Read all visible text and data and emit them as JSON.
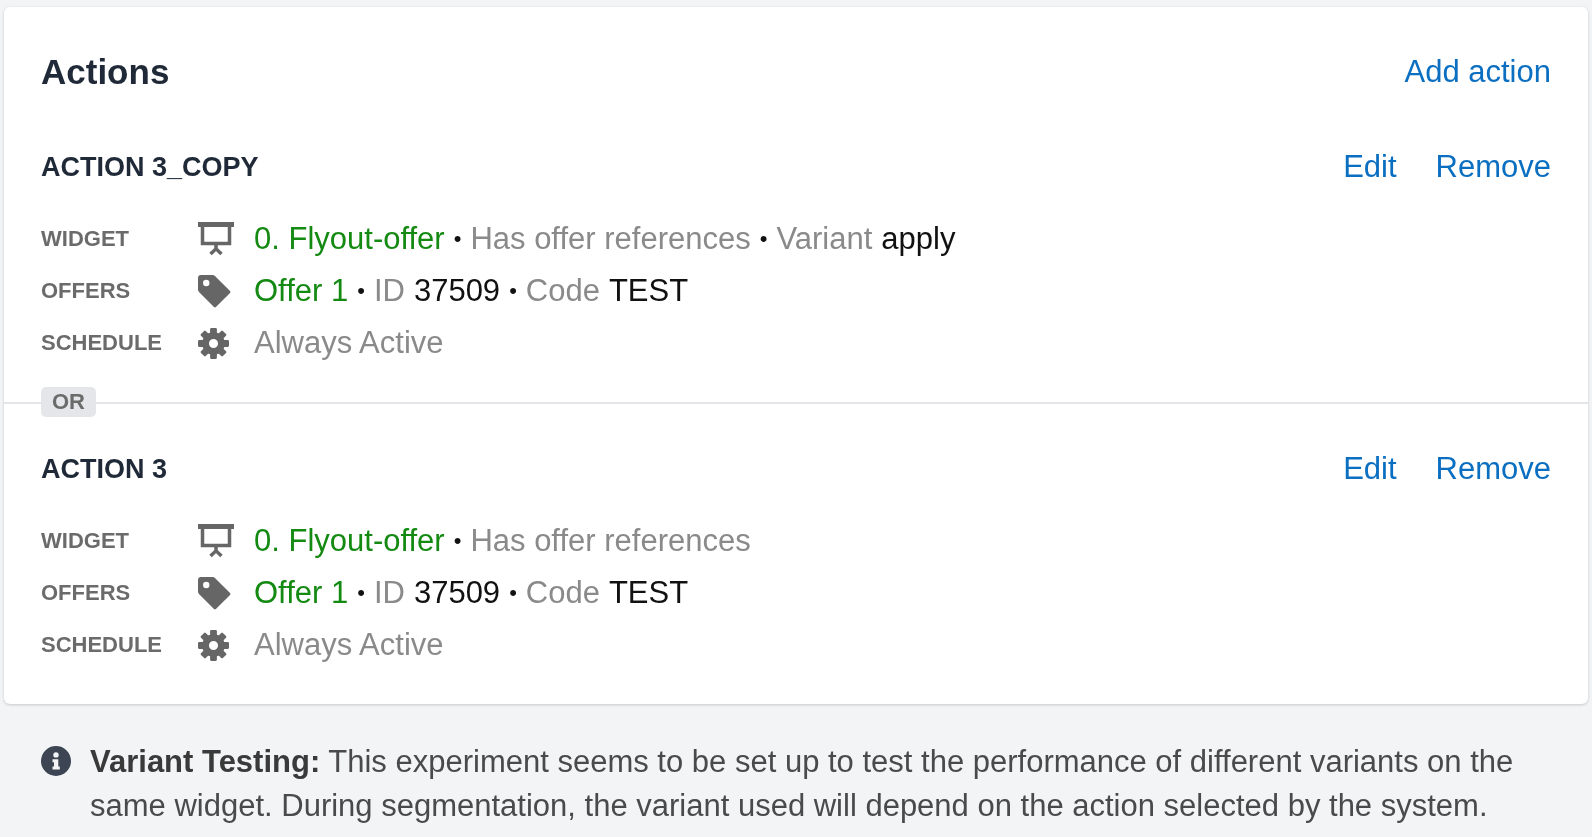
{
  "panel": {
    "title": "Actions",
    "add_link": "Add action"
  },
  "actions": [
    {
      "name": "ACTION 3_COPY",
      "links": [
        "Edit",
        "Remove"
      ],
      "details": [
        {
          "kind": "widget",
          "label": "WIDGET",
          "parts": [
            {
              "kind": "link",
              "text": "0. Flyout-offer"
            },
            {
              "kind": "bullet",
              "text": "•"
            },
            {
              "kind": "muted",
              "text": "Has offer references"
            },
            {
              "kind": "bullet",
              "text": "•"
            },
            {
              "kind": "muted",
              "text": "Variant"
            },
            {
              "kind": "strong",
              "text": "apply"
            }
          ]
        },
        {
          "kind": "offers",
          "label": "OFFERS",
          "parts": [
            {
              "kind": "link",
              "text": "Offer 1"
            },
            {
              "kind": "bullet",
              "text": "•"
            },
            {
              "kind": "muted",
              "text": "ID"
            },
            {
              "kind": "strong",
              "text": "37509"
            },
            {
              "kind": "bullet",
              "text": "•"
            },
            {
              "kind": "muted",
              "text": "Code"
            },
            {
              "kind": "strong",
              "text": "TEST"
            }
          ]
        },
        {
          "kind": "schedule",
          "label": "SCHEDULE",
          "parts": [
            {
              "kind": "muted",
              "text": "Always Active"
            }
          ]
        }
      ]
    },
    {
      "name": "ACTION 3",
      "links": [
        "Edit",
        "Remove"
      ],
      "details": [
        {
          "kind": "widget",
          "label": "WIDGET",
          "parts": [
            {
              "kind": "link",
              "text": "0. Flyout-offer"
            },
            {
              "kind": "bullet",
              "text": "•"
            },
            {
              "kind": "muted",
              "text": "Has offer references"
            }
          ]
        },
        {
          "kind": "offers",
          "label": "OFFERS",
          "parts": [
            {
              "kind": "link",
              "text": "Offer 1"
            },
            {
              "kind": "bullet",
              "text": "•"
            },
            {
              "kind": "muted",
              "text": "ID"
            },
            {
              "kind": "strong",
              "text": "37509"
            },
            {
              "kind": "bullet",
              "text": "•"
            },
            {
              "kind": "muted",
              "text": "Code"
            },
            {
              "kind": "strong",
              "text": "TEST"
            }
          ]
        },
        {
          "kind": "schedule",
          "label": "SCHEDULE",
          "parts": [
            {
              "kind": "muted",
              "text": "Always Active"
            }
          ]
        }
      ]
    }
  ],
  "separator": "OR",
  "note": {
    "text": "**Variant Testing:** This experiment seems to be set up to test the performance of different variants on the same widget. During segmentation, the variant used will depend on the action selected by the system."
  }
}
